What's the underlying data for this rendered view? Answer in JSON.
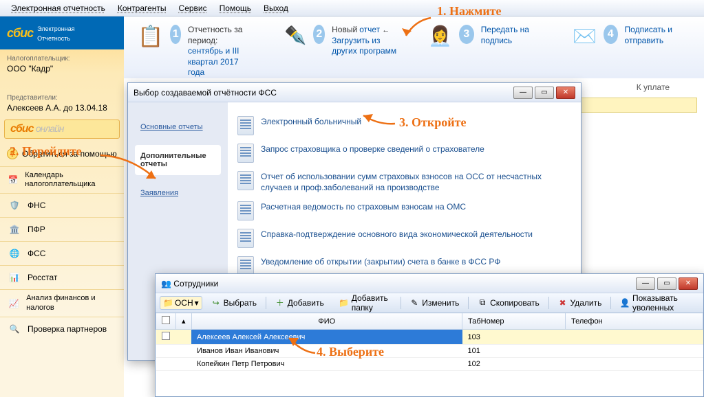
{
  "menu": {
    "i0": "Электронная отчетность",
    "i1": "Контрагенты",
    "i2": "Сервис",
    "i3": "Помощь",
    "i4": "Выход"
  },
  "logo": {
    "brand": "сбис",
    "sub1": "Электронная",
    "sub2": "Отчетность"
  },
  "side": {
    "tp_lbl": "Налогоплательщик:",
    "tp_val": "ООО \"Кадр\"",
    "rep_lbl": "Представители:",
    "rep_val": "Алексеев А.А. до 13.04.18",
    "online_a": "сбис",
    "online_b": "онлайн",
    "help": "Обратиться за помощью",
    "nav": {
      "cal": "Календарь налогоплательщика",
      "fns": "ФНС",
      "pfr": "ПФР",
      "fss": "ФСС",
      "rosstat": "Росстат",
      "fin": "Анализ финансов и налогов",
      "check": "Проверка партнеров"
    }
  },
  "steps": {
    "s1": {
      "a": "Отчетность за период:",
      "b": "сентябрь и III квартал 2017 года"
    },
    "s2": {
      "a": "Новый",
      "b": "отчет",
      "c": "Загрузить из других программ"
    },
    "s3": {
      "a": "Передать на подпись"
    },
    "s4": {
      "a": "Подписать и отправить"
    },
    "kuplate": "К уплате"
  },
  "dialog": {
    "title": "Выбор создаваемой отчётности ФСС",
    "tabs": {
      "main": "Основные отчеты",
      "extra": "Дополнительные отчеты",
      "app": "Заявления"
    },
    "items": {
      "0": "Электронный больничный",
      "1": "Запрос страховщика о проверке сведений о страхователе",
      "2": "Отчет об использовании сумм страховых взносов на ОСС от несчастных случаев и проф.заболеваний на производстве",
      "3": "Расчетная ведомость по страховым взносам на ОМС",
      "4": "Справка-подтверждение основного вида экономической деятельности",
      "5": "Уведомление об открытии (закрытии) счета в банке в ФСС РФ"
    }
  },
  "emp": {
    "title": "Сотрудники",
    "btns": {
      "folder": "ОСН",
      "sel": "Выбрать",
      "add": "Добавить",
      "addf": "Добавить папку",
      "edit": "Изменить",
      "copy": "Скопировать",
      "del": "Удалить",
      "show": "Показывать уволенных"
    },
    "cols": {
      "fio": "ФИО",
      "tab": "ТабНомер",
      "tel": "Телефон"
    },
    "rows": {
      "0": {
        "fio": "Алексеев Алексей Алексеевич",
        "tab": "103"
      },
      "1": {
        "fio": "Иванов Иван Иванович",
        "tab": "101"
      },
      "2": {
        "fio": "Копейкин Петр Петрович",
        "tab": "102"
      }
    }
  },
  "call": {
    "c1": "1. Нажмите",
    "c2": "2. Перейдите",
    "c3": "3. Откройте",
    "c4": "4. Выберите"
  }
}
